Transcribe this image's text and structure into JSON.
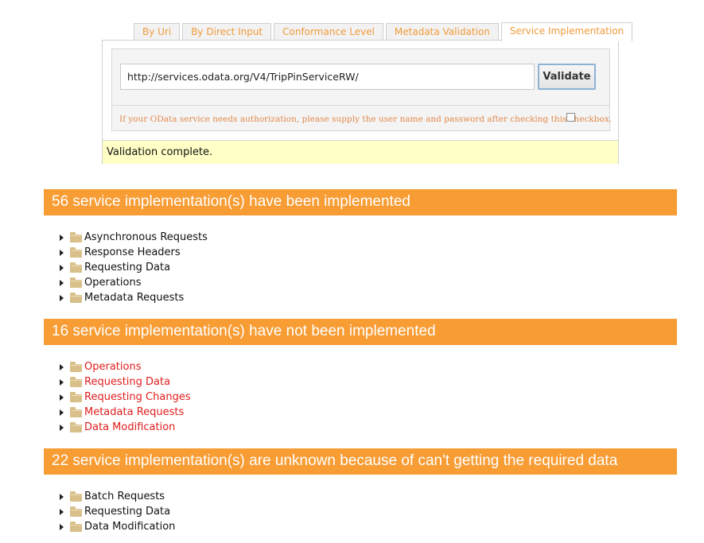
{
  "tabs": [
    {
      "label": "By Uri",
      "active": false
    },
    {
      "label": "By Direct Input",
      "active": false
    },
    {
      "label": "Conformance Level",
      "active": false
    },
    {
      "label": "Metadata Validation",
      "active": false
    },
    {
      "label": "Service Implementation",
      "active": true
    }
  ],
  "form": {
    "url_value": "http://services.odata.org/V4/TripPinServiceRW/",
    "validate_label": "Validate",
    "auth_text": "If your OData service needs authorization, please supply the user name and password after checking this checkbox.",
    "auth_checked": false
  },
  "status": {
    "message": "Validation complete."
  },
  "sections": [
    {
      "title": "56 service implementation(s) have been implemented",
      "items": [
        "Asynchronous Requests",
        "Response Headers",
        "Requesting Data",
        "Operations",
        "Metadata Requests"
      ]
    },
    {
      "title": "16 service implementation(s) have not been implemented",
      "items": [
        "Operations",
        "Requesting Data",
        "Requesting Changes",
        "Metadata Requests",
        "Data Modification"
      ]
    },
    {
      "title": "22 service implementation(s) are unknown because of can't getting the required data",
      "items": [
        "Batch Requests",
        "Requesting Data",
        "Data Modification"
      ]
    }
  ],
  "colors": {
    "accent": "#f89c34",
    "tab_text": "#f19a3a",
    "status_bg": "#ffffc6",
    "not_implemented_text": "#e01c1c"
  }
}
